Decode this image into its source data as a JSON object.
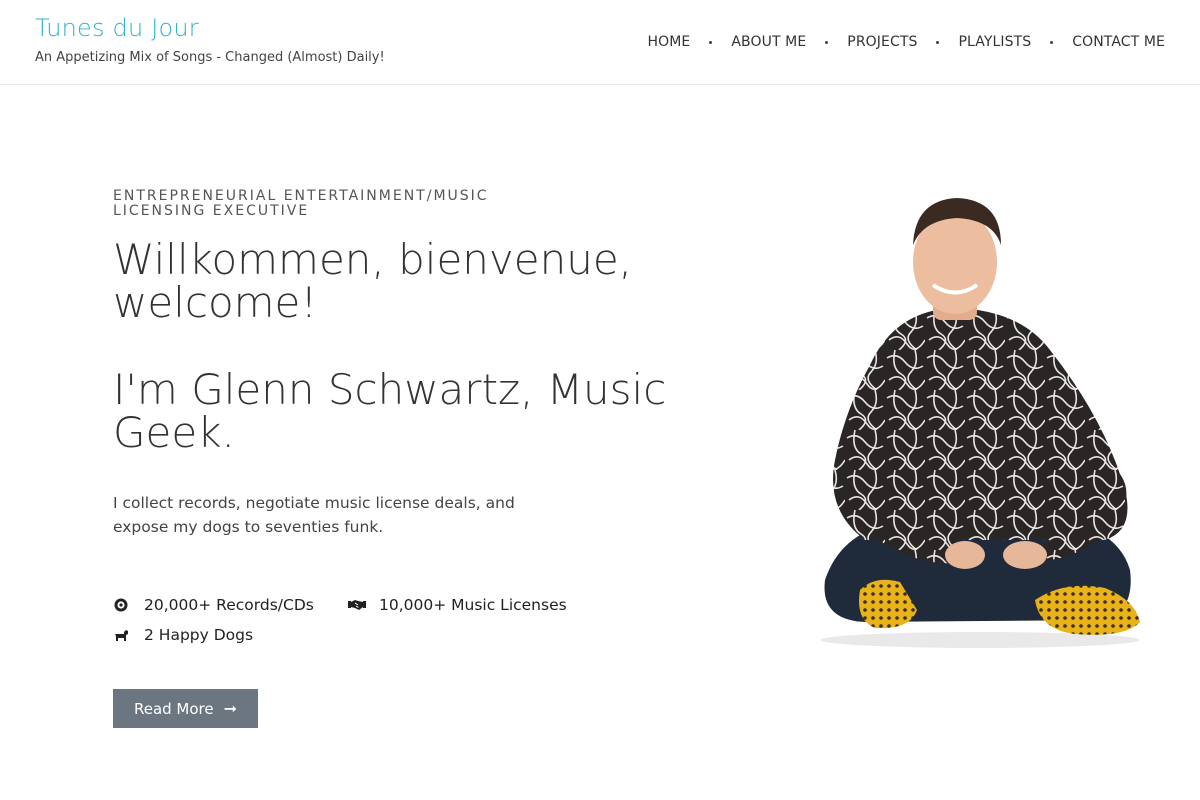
{
  "site": {
    "title": "Tunes du Jour",
    "tagline": "An Appetizing Mix of Songs - Changed (Almost) Daily!"
  },
  "nav": {
    "items": [
      {
        "label": "HOME"
      },
      {
        "label": "ABOUT ME"
      },
      {
        "label": "PROJECTS"
      },
      {
        "label": "PLAYLISTS"
      },
      {
        "label": "CONTACT ME"
      }
    ]
  },
  "hero": {
    "eyebrow": "ENTREPRENEURIAL ENTERTAINMENT/MUSIC LICENSING EXECUTIVE",
    "heading_1": "Willkommen, bienvenue, welcome!",
    "heading_2": "I'm Glenn Schwartz, Music Geek.",
    "lead": "I collect records, negotiate music license deals, and expose my dogs to seventies funk.",
    "stats": [
      {
        "label": "20,000+ Records/CDs",
        "icon": "record-icon"
      },
      {
        "label": "10,000+ Music Licenses",
        "icon": "handshake-icon"
      },
      {
        "label": "2 Happy Dogs",
        "icon": "dog-icon"
      }
    ],
    "button_label": "Read More",
    "button_icon": "arrow-right-icon"
  },
  "colors": {
    "brand": "#2fb3c9",
    "button": "#6b7681",
    "text": "#333333"
  }
}
